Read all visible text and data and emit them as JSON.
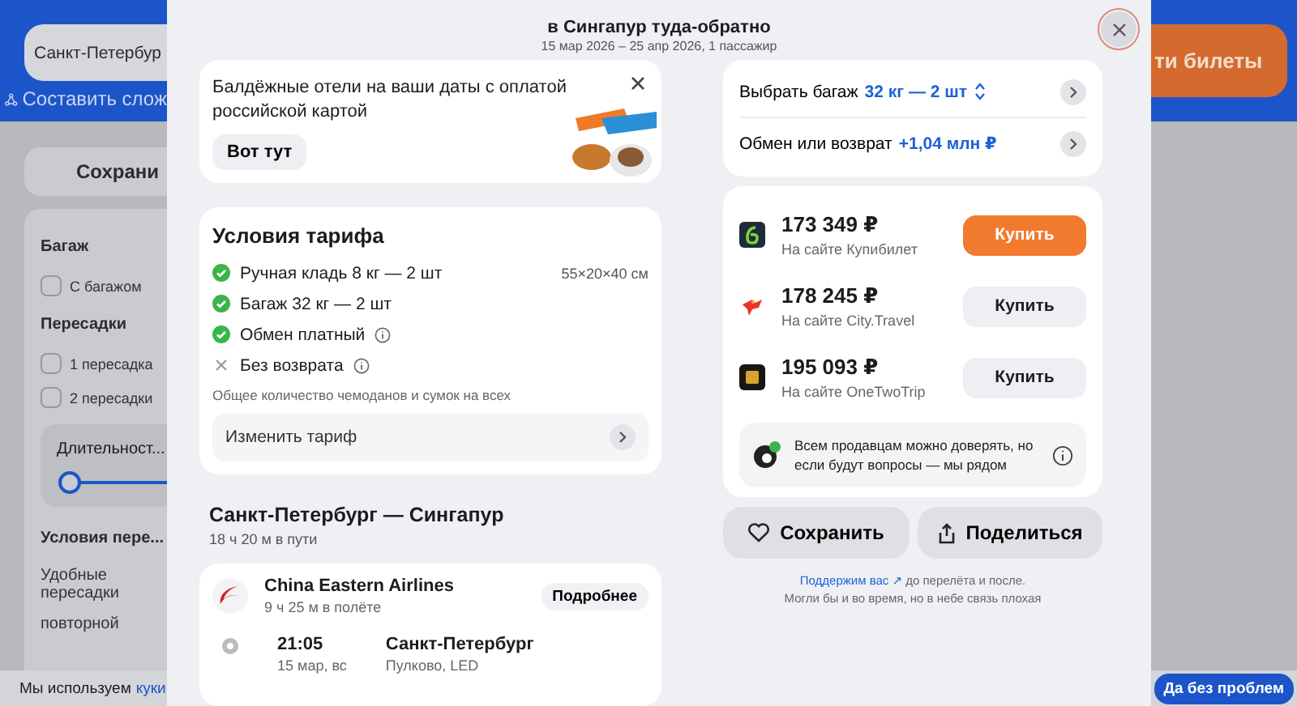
{
  "background": {
    "search_value": "Санкт-Петербур",
    "compose_link": "Составить слож",
    "find_button": "ти билеты",
    "save_button": "Сохрани",
    "filters": [
      {
        "kind": "heading",
        "text": "Багаж"
      },
      {
        "kind": "checkbox",
        "text": "С багажом",
        "checked": false
      },
      {
        "kind": "heading",
        "text": "Пересадки"
      },
      {
        "kind": "checkbox",
        "text": "1 пересадка",
        "checked": false
      },
      {
        "kind": "checkbox",
        "text": "2 пересадки",
        "checked": false
      },
      {
        "kind": "slider",
        "text": "Длительност...",
        "level": 0
      },
      {
        "kind": "heading",
        "text": "Условия пере..."
      },
      {
        "kind": "option",
        "text": "Удобные пересадки"
      },
      {
        "kind": "option",
        "text": "повторной"
      }
    ],
    "cookie_text": "Мы используем",
    "cookie_link": "куки",
    "cookie_button": "Да без проблем"
  },
  "modal": {
    "title": "в Сингапур туда-обратно",
    "subtitle": "15 мар 2026 – 25 апр 2026, 1 пассажир",
    "promo": {
      "text": "Балдёжные отели на ваши даты с оплатой российской картой",
      "button": "Вот тут"
    },
    "tariff": {
      "title": "Условия тарифа",
      "items": [
        {
          "kind": "included",
          "text": "Ручная кладь 8 кг — 2 шт",
          "note": "55×20×40 см",
          "info": false
        },
        {
          "kind": "included",
          "text": "Багаж 32 кг — 2 шт",
          "info": false
        },
        {
          "kind": "included",
          "text": "Обмен платный",
          "info": true
        },
        {
          "kind": "excluded",
          "text": "Без возврата",
          "info": true
        }
      ],
      "footnote": "Общее количество чемоданов и сумок на всех",
      "change_button": "Изменить тариф"
    },
    "route": {
      "title": "Санкт-Петербург — Сингапур",
      "duration": "18 ч 20 м в пути"
    },
    "flight": {
      "airline": "China Eastern Airlines",
      "time_in_air": "9 ч 25 м в полёте",
      "details_button": "Подробнее",
      "stops": [
        {
          "time": "21:05",
          "date": "15 мар, вс",
          "city": "Санкт-Петербург",
          "airport": "Пулково, LED"
        }
      ]
    },
    "options": [
      {
        "label": "Выбрать багаж",
        "value": "32 кг — 2 шт",
        "kind": "select"
      },
      {
        "label": "Обмен или возврат",
        "value": "+1,04 млн ₽",
        "kind": "plain"
      }
    ],
    "offers": [
      {
        "price": "173 349 ₽",
        "seller": "На сайте Купибилет",
        "button": "Купить",
        "kind": "primary"
      },
      {
        "price": "178 245 ₽",
        "seller": "На сайте City.Travel",
        "button": "Купить",
        "kind": "secondary"
      },
      {
        "price": "195 093 ₽",
        "seller": "На сайте OneTwoTrip",
        "button": "Купить",
        "kind": "secondary"
      }
    ],
    "trust": "Всем продавцам можно доверять, но если будут вопросы — мы рядом",
    "save_button": "Сохранить",
    "share_button": "Поделиться",
    "support_link": "Поддержим вас ↗",
    "support_text": "до перелёта и после.",
    "support_text_2": "Могли бы и во время, но в небе связь плохая"
  }
}
